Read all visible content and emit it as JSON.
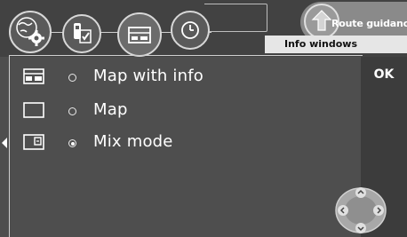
{
  "header": {
    "tabs": [
      {
        "name": "globe-gear",
        "icon": "globe-settings-icon",
        "selected": false
      },
      {
        "name": "phone-checklist",
        "icon": "phone-checklist-icon",
        "selected": false
      },
      {
        "name": "info-windows",
        "icon": "window-icon",
        "selected": true
      },
      {
        "name": "clock",
        "icon": "clock-icon",
        "selected": false
      }
    ],
    "route_guidance_label": "Route guidance",
    "active_section_label": "Info windows"
  },
  "options": [
    {
      "label": "Map with info",
      "icon": "map-with-info-icon",
      "selected": false
    },
    {
      "label": "Map",
      "icon": "map-icon",
      "selected": false
    },
    {
      "label": "Mix mode",
      "icon": "mix-mode-icon",
      "selected": true
    }
  ],
  "actions": {
    "ok_label": "OK"
  },
  "colors": {
    "background": "#4e4e4e",
    "header": "#424242",
    "right_panel": "#3c3c3c",
    "info_tab": "#e6e6e6",
    "text": "#ffffff"
  }
}
